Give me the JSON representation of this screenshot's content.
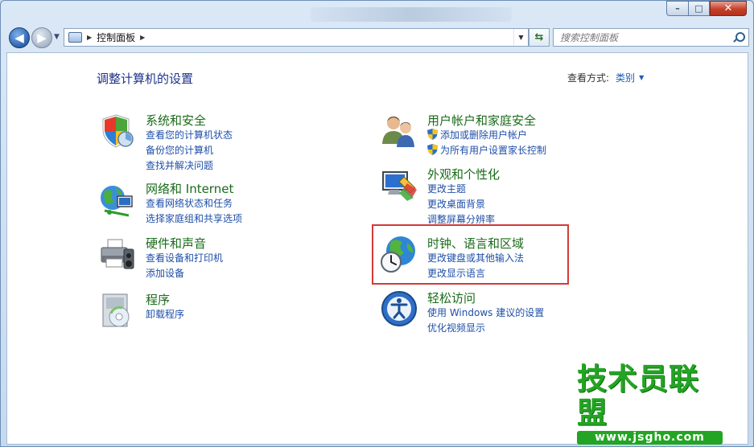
{
  "window": {
    "controls": {
      "minimize": "–",
      "maximize": "□",
      "close": "✕"
    }
  },
  "nav": {
    "back_icon": "arrow-left-icon",
    "forward_icon": "arrow-right-icon",
    "breadcrumb_sep": "▶",
    "address": "控制面板",
    "refresh_symbol": "⇆",
    "search_placeholder": "搜索控制面板"
  },
  "main": {
    "title": "调整计算机的设置",
    "view_by_label": "查看方式:",
    "view_by_value": "类别",
    "view_by_caret": "▼"
  },
  "categories_left": [
    {
      "title": "系统和安全",
      "links": [
        "查看您的计算机状态",
        "备份您的计算机",
        "查找并解决问题"
      ]
    },
    {
      "title": "网络和 Internet",
      "links": [
        "查看网络状态和任务",
        "选择家庭组和共享选项"
      ]
    },
    {
      "title": "硬件和声音",
      "links": [
        "查看设备和打印机",
        "添加设备"
      ]
    },
    {
      "title": "程序",
      "links": [
        "卸载程序"
      ]
    }
  ],
  "categories_right": [
    {
      "title": "用户帐户和家庭安全",
      "links": [
        "添加或删除用户帐户",
        "为所有用户设置家长控制"
      ]
    },
    {
      "title": "外观和个性化",
      "links": [
        "更改主题",
        "更改桌面背景",
        "调整屏幕分辨率"
      ]
    },
    {
      "title": "时钟、语言和区域",
      "links": [
        "更改键盘或其他输入法",
        "更改显示语言"
      ]
    },
    {
      "title": "轻松访问",
      "links": [
        "使用 Windows 建议的设置",
        "优化视频显示"
      ]
    }
  ],
  "watermark": {
    "main": "技术员联盟",
    "url": "www.jsgho.com"
  },
  "colors": {
    "category_title": "#1a6b1a",
    "link": "#1e4fa8",
    "highlight": "#d23a3a",
    "watermark": "#23a523"
  }
}
